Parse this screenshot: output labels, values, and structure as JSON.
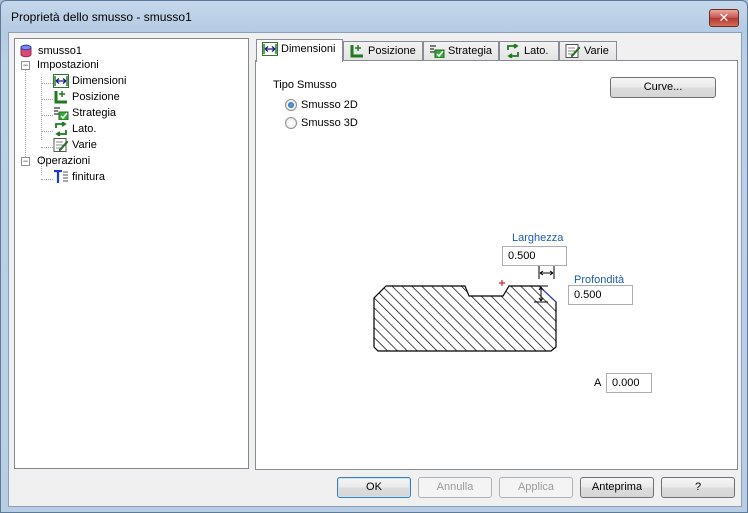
{
  "window": {
    "title": "Proprietà dello smusso - smusso1",
    "close_label": "✕"
  },
  "tree": {
    "root": "smusso1",
    "impostazioni": "Impostazioni",
    "dimensioni": "Dimensioni",
    "posizione": "Posizione",
    "strategia": "Strategia",
    "lato": "Lato.",
    "varie": "Varie",
    "operazioni": "Operazioni",
    "finitura": "finitura",
    "expander_symbol": "−"
  },
  "tabs": {
    "dimensioni": "Dimensioni",
    "posizione": "Posizione",
    "strategia": "Strategia",
    "lato": "Lato.",
    "varie": "Varie"
  },
  "panel": {
    "tipo_smusso_label": "Tipo Smusso",
    "radio_2d": "Smusso 2D",
    "radio_3d": "Smusso 3D",
    "selected_radio": "Smusso 2D",
    "curve_button": "Curve...",
    "larghezza_label": "Larghezza",
    "larghezza_value": "0.500",
    "profondita_label": "Profondità",
    "profondita_value": "0.500",
    "a_label": "A",
    "a_value": "0.000"
  },
  "buttons": {
    "ok": "OK",
    "annulla": "Annulla",
    "applica": "Applica",
    "anteprima": "Anteprima",
    "help": "?"
  }
}
